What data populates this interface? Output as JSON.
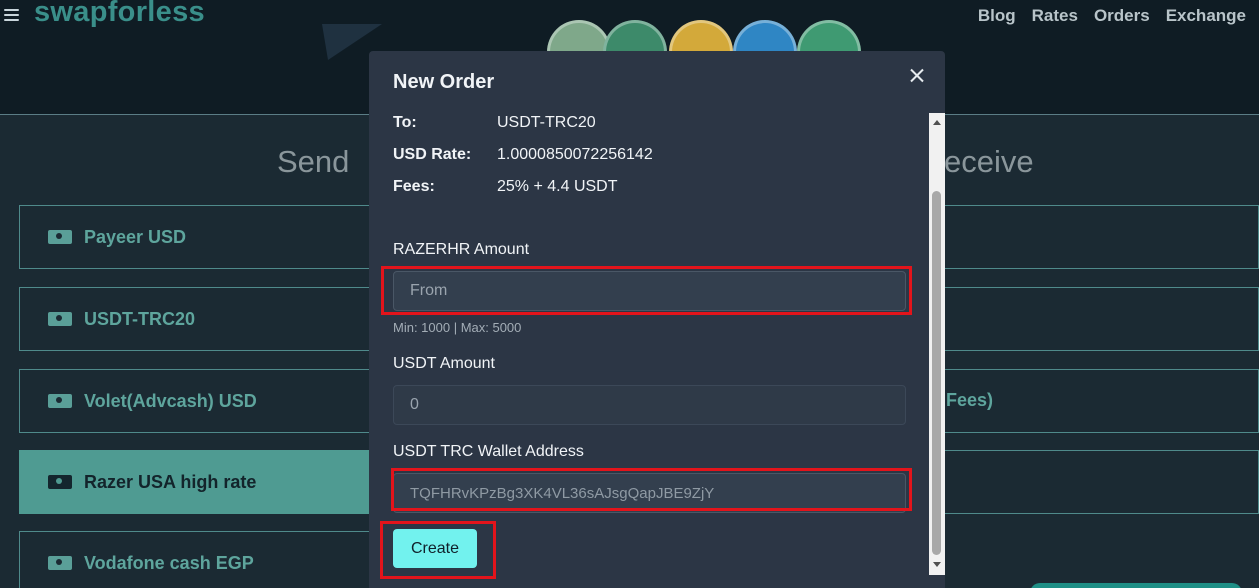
{
  "app": {
    "logo": "swapforless",
    "nav": [
      "Blog",
      "Rates",
      "Orders",
      "Exchange"
    ]
  },
  "columns": {
    "send_title": "Send",
    "receive_title": "eceive"
  },
  "send_list": [
    {
      "label": "Payeer USD",
      "icon": "money-icon"
    },
    {
      "label": "USDT-TRC20",
      "icon": "money-icon"
    },
    {
      "label": "Volet(Advcash) USD",
      "icon": "money-icon"
    },
    {
      "label": "Razer USA high rate",
      "icon": "money-icon",
      "active": true
    },
    {
      "label": "Vodafone cash EGP",
      "icon": "money-icon"
    }
  ],
  "receive_list": [
    {
      "label": ""
    },
    {
      "label": ""
    },
    {
      "label": "Fees)"
    },
    {
      "label": ""
    }
  ],
  "modal": {
    "title": "New Order",
    "info": [
      {
        "key": "To:",
        "value": "USDT-TRC20"
      },
      {
        "key": "USD Rate:",
        "value": "1.0000850072256142"
      },
      {
        "key": "Fees:",
        "value": "25% + 4.4 USDT"
      }
    ],
    "from_label": "RAZERHR Amount",
    "from_placeholder": "From",
    "from_hint": "Min: 1000 | Max: 5000",
    "to_label": "USDT Amount",
    "to_placeholder": "0",
    "wallet_label": "USDT TRC Wallet Address",
    "wallet_value": "TQFHRvKPzBg3XK4VL36sAJsgQapJBE9ZjY",
    "create_label": "Create"
  },
  "colors": {
    "accent": "#72f2ee",
    "highlight": "#e3141b",
    "brand": "#3a8f8a"
  }
}
